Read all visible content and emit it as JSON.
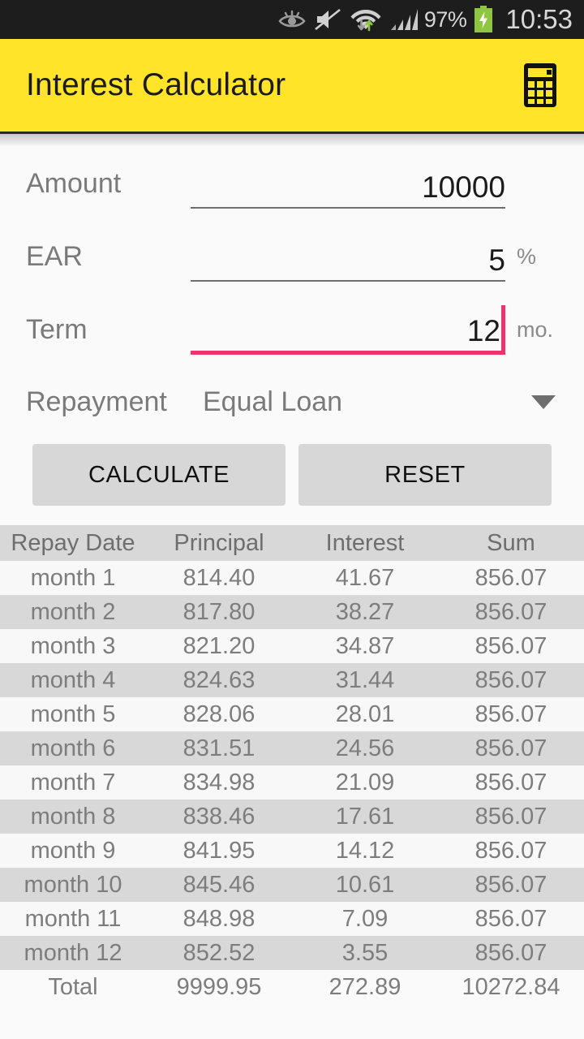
{
  "status_bar": {
    "icons": [
      "smart-stay-eye-icon",
      "sound-muted-icon",
      "wifi-icon",
      "signal-bars-icon"
    ],
    "battery_percent": "97%",
    "battery_state": "charging",
    "clock": "10:53",
    "colors": {
      "background": "#1d1d1d",
      "text": "#d8d8d8",
      "battery": "#8ec63f"
    }
  },
  "toolbar": {
    "title": "Interest Calculator",
    "action_icon": "calculator-icon",
    "colors": {
      "background": "#ffe429",
      "text": "#1b1b1b"
    }
  },
  "form": {
    "fields": [
      {
        "label": "Amount",
        "value": "10000",
        "unit": "",
        "focused": false
      },
      {
        "label": "EAR",
        "value": "5",
        "unit": "%",
        "focused": false
      },
      {
        "label": "Term",
        "value": "12",
        "unit": "mo.",
        "focused": true
      }
    ],
    "spinner": {
      "label": "Repayment",
      "selected": "Equal Loan",
      "caret_icon": "chevron-down-icon"
    },
    "buttons": {
      "calculate": "CALCULATE",
      "reset": "RESET"
    },
    "focus_color": "#f2316f"
  },
  "table": {
    "headers": [
      "Repay Date",
      "Principal",
      "Interest",
      "Sum"
    ],
    "rows": [
      [
        "month 1",
        "814.40",
        "41.67",
        "856.07"
      ],
      [
        "month 2",
        "817.80",
        "38.27",
        "856.07"
      ],
      [
        "month 3",
        "821.20",
        "34.87",
        "856.07"
      ],
      [
        "month 4",
        "824.63",
        "31.44",
        "856.07"
      ],
      [
        "month 5",
        "828.06",
        "28.01",
        "856.07"
      ],
      [
        "month 6",
        "831.51",
        "24.56",
        "856.07"
      ],
      [
        "month 7",
        "834.98",
        "21.09",
        "856.07"
      ],
      [
        "month 8",
        "838.46",
        "17.61",
        "856.07"
      ],
      [
        "month 9",
        "841.95",
        "14.12",
        "856.07"
      ],
      [
        "month 10",
        "845.46",
        "10.61",
        "856.07"
      ],
      [
        "month 11",
        "848.98",
        "7.09",
        "856.07"
      ],
      [
        "month 12",
        "852.52",
        "3.55",
        "856.07"
      ]
    ],
    "total_row": [
      "Total",
      "9999.95",
      "272.89",
      "10272.84"
    ]
  }
}
